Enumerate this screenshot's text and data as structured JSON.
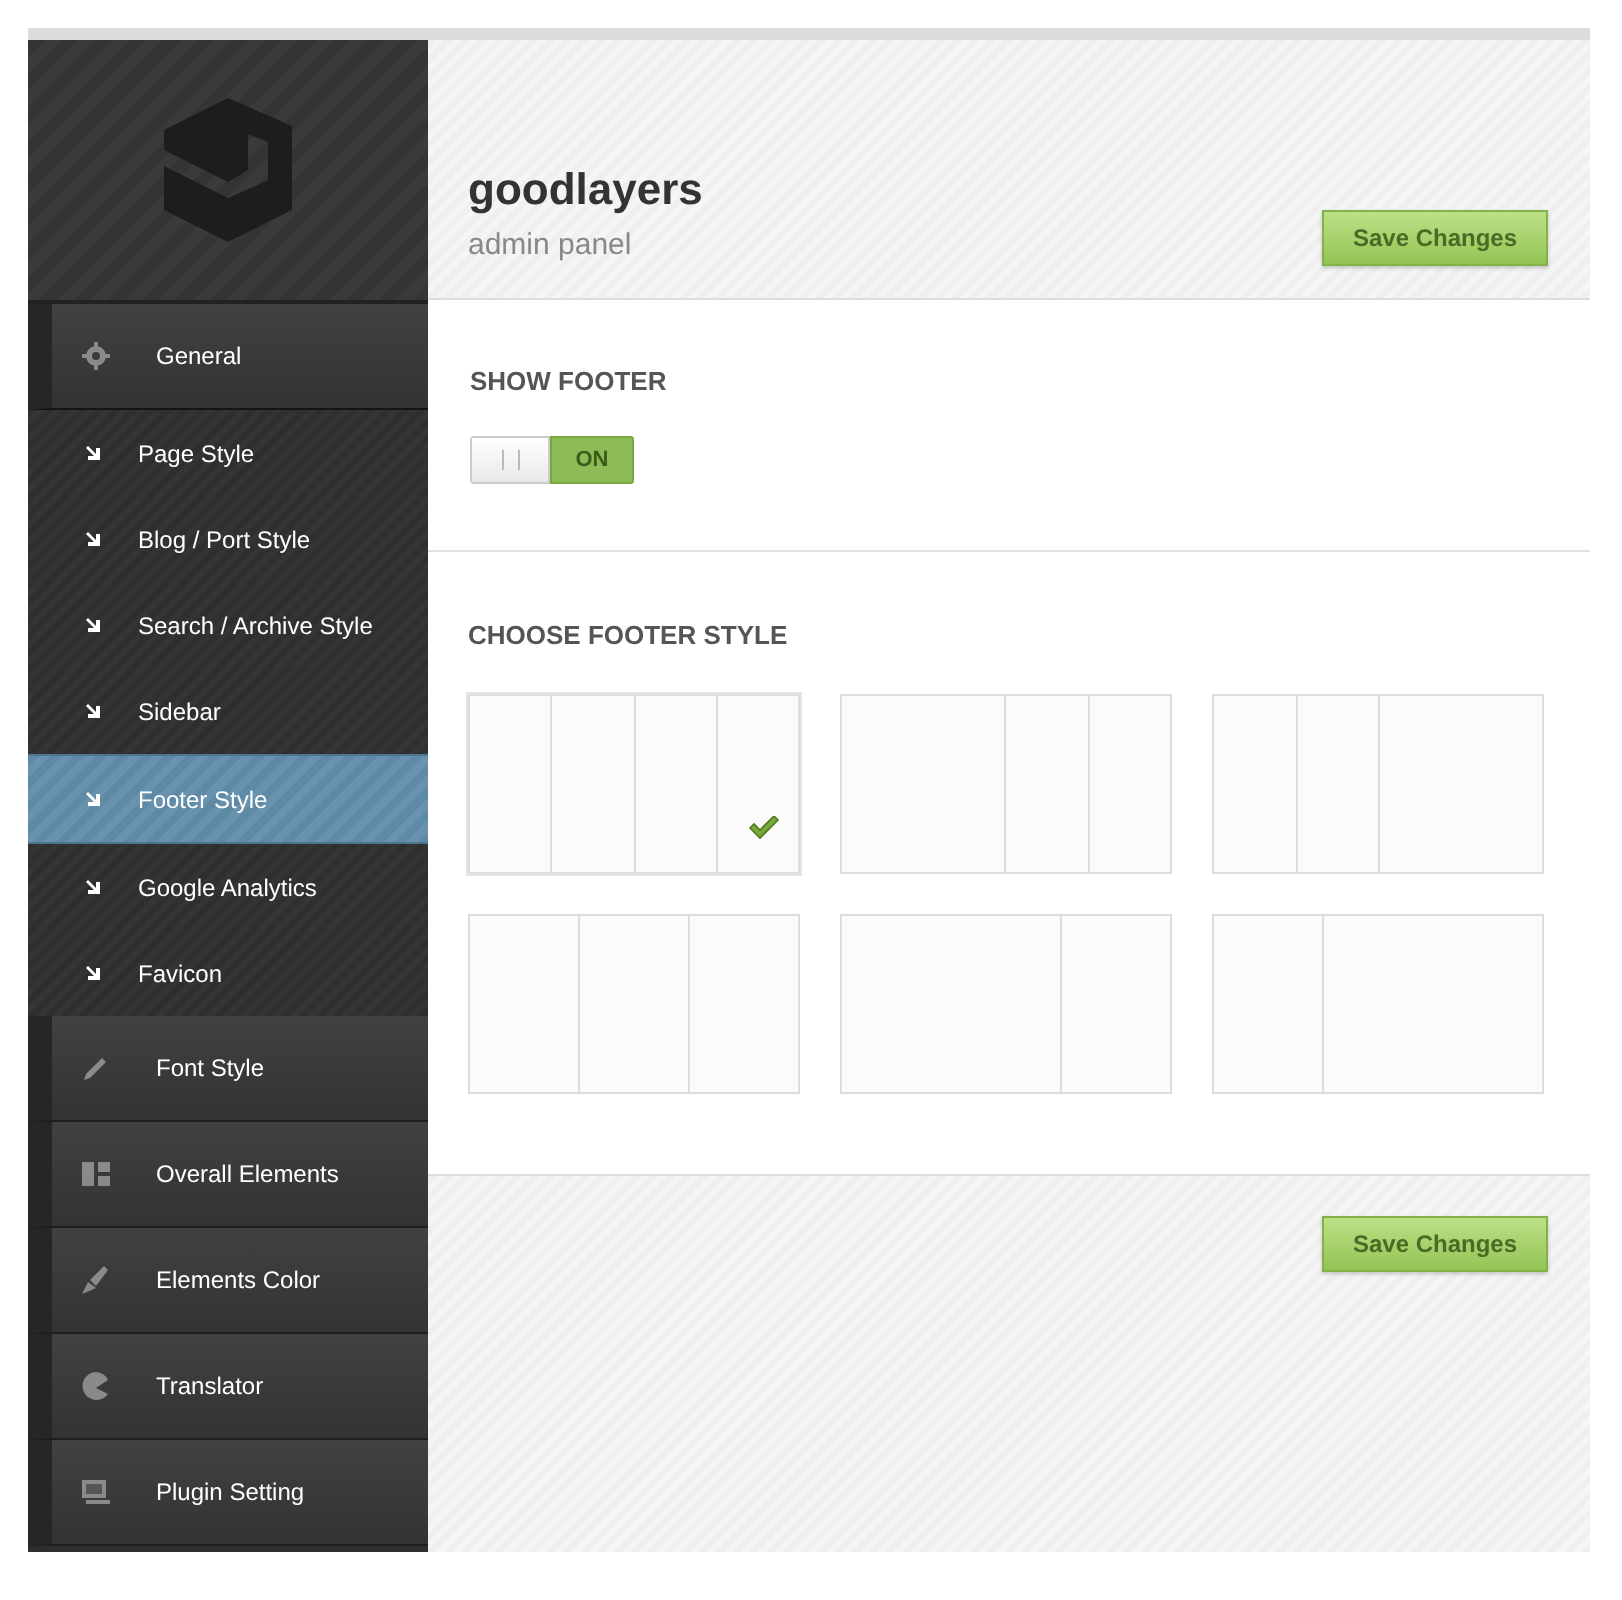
{
  "header": {
    "title": "goodlayers",
    "subtitle": "admin panel",
    "save_button": "Save Changes"
  },
  "sidebar": {
    "items": [
      {
        "label": "General",
        "selected": false,
        "expanded": true,
        "children": [
          {
            "label": "Page Style",
            "selected": false
          },
          {
            "label": "Blog / Port Style",
            "selected": false
          },
          {
            "label": "Search / Archive Style",
            "selected": false
          },
          {
            "label": "Sidebar",
            "selected": false
          },
          {
            "label": "Footer Style",
            "selected": true
          },
          {
            "label": "Google Analytics",
            "selected": false
          },
          {
            "label": "Favicon",
            "selected": false
          }
        ]
      },
      {
        "label": "Font Style",
        "selected": false,
        "expanded": false
      },
      {
        "label": "Overall Elements",
        "selected": false,
        "expanded": false
      },
      {
        "label": "Elements Color",
        "selected": false,
        "expanded": false
      },
      {
        "label": "Translator",
        "selected": false,
        "expanded": false
      },
      {
        "label": "Plugin Setting",
        "selected": false,
        "expanded": false
      }
    ]
  },
  "show_footer": {
    "label": "SHOW FOOTER",
    "on": true,
    "text": "ON"
  },
  "footer_style": {
    "label": "CHOOSE FOOTER STYLE",
    "options": [
      {
        "kind": "quarters",
        "selected": true
      },
      {
        "kind": "halfquarters",
        "selected": false
      },
      {
        "kind": "quartershalf",
        "selected": false
      },
      {
        "kind": "thirds",
        "selected": false
      },
      {
        "kind": "twothirdsthird",
        "selected": false
      },
      {
        "kind": "thirdtwothirds",
        "selected": false
      }
    ]
  },
  "footer_button": "Save Changes"
}
